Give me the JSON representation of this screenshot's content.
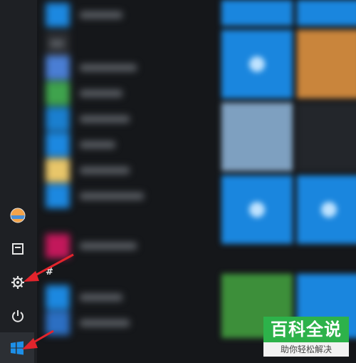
{
  "rail": {
    "items": [
      {
        "name": "user-avatar",
        "icon": "avatar-icon"
      },
      {
        "name": "documents-button",
        "icon": "document-icon"
      },
      {
        "name": "settings-button",
        "icon": "gear-icon"
      },
      {
        "name": "power-button",
        "icon": "power-icon"
      },
      {
        "name": "start-button",
        "icon": "windows-logo-icon"
      }
    ]
  },
  "applist": {
    "section_marker": "#"
  },
  "annotation": {
    "arrow_color": "#e2242c"
  },
  "watermark": {
    "title": "百科全说",
    "subtitle": "助你轻松解决"
  },
  "colors": {
    "tile_blue": "#1a86de",
    "rail_bg": "#1e2024",
    "watermark_green": "#2db24a"
  }
}
